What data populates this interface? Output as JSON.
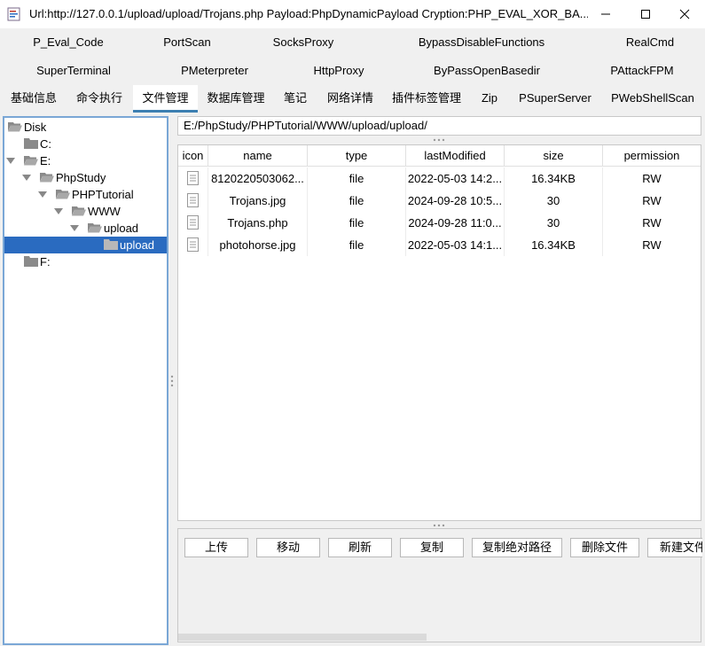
{
  "window": {
    "title": "Url:http://127.0.0.1/upload/upload/Trojans.php Payload:PhpDynamicPayload Cryption:PHP_EVAL_XOR_BA...",
    "minimize_icon": "minimize-icon",
    "maximize_icon": "maximize-icon",
    "close_icon": "close-icon"
  },
  "plugins": {
    "row1": [
      "P_Eval_Code",
      "PortScan",
      "SocksProxy",
      "BypassDisableFunctions",
      "RealCmd"
    ],
    "row2": [
      "SuperTerminal",
      "PMeterpreter",
      "HttpProxy",
      "ByPassOpenBasedir",
      "PAttackFPM"
    ]
  },
  "tabs": [
    "基础信息",
    "命令执行",
    "文件管理",
    "数据库管理",
    "笔记",
    "网络详情",
    "插件标签管理",
    "Zip",
    "PSuperServer",
    "PWebShellScan"
  ],
  "active_tab": "文件管理",
  "tree": {
    "nodes": [
      "Disk",
      "C:",
      "E:",
      "PhpStudy",
      "PHPTutorial",
      "WWW",
      "upload",
      "upload",
      "F:"
    ],
    "selected": "upload"
  },
  "path": "E:/PhpStudy/PHPTutorial/WWW/upload/upload/",
  "table": {
    "columns": [
      "icon",
      "name",
      "type",
      "lastModified",
      "size",
      "permission"
    ],
    "rows": [
      {
        "name": "8120220503062...",
        "type": "file",
        "lastModified": "2022-05-03 14:2...",
        "size": "16.34KB",
        "permission": "RW"
      },
      {
        "name": "Trojans.jpg",
        "type": "file",
        "lastModified": "2024-09-28 10:5...",
        "size": "30",
        "permission": "RW"
      },
      {
        "name": "Trojans.php",
        "type": "file",
        "lastModified": "2024-09-28 11:0...",
        "size": "30",
        "permission": "RW"
      },
      {
        "name": "photohorse.jpg",
        "type": "file",
        "lastModified": "2022-05-03 14:1...",
        "size": "16.34KB",
        "permission": "RW"
      }
    ]
  },
  "buttons": [
    "上传",
    "移动",
    "刷新",
    "复制",
    "复制绝对路径",
    "删除文件",
    "新建文件"
  ],
  "colors": {
    "accent": "#3c7fb1",
    "selection": "#2a6bc0",
    "tree_border": "#7aa7d6",
    "panel_bg": "#f0f0f0"
  }
}
